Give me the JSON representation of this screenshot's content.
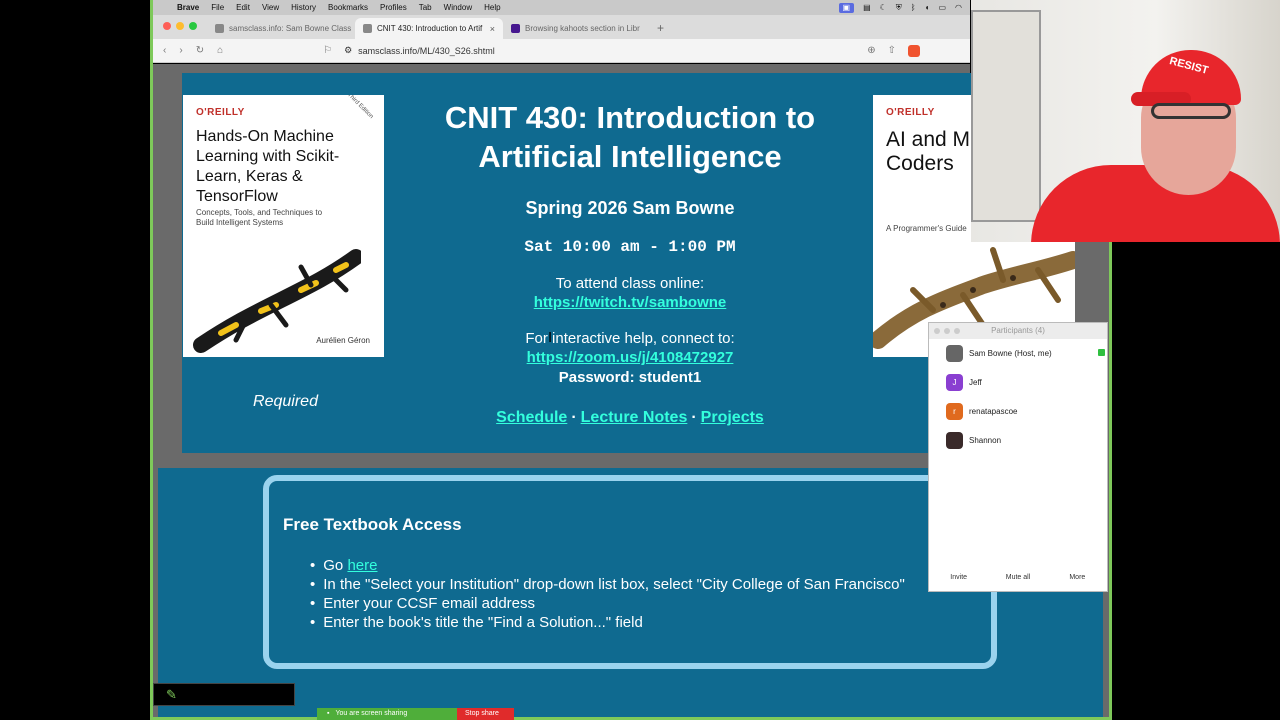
{
  "menubar": {
    "items": [
      "Brave",
      "File",
      "Edit",
      "View",
      "History",
      "Bookmarks",
      "Profiles",
      "Tab",
      "Window",
      "Help"
    ]
  },
  "tabs": [
    {
      "title": "samsclass.info: Sam Bowne Class"
    },
    {
      "title": "CNIT 430: Introduction to Artif"
    },
    {
      "title": "Browsing kahoots section in Libr"
    }
  ],
  "address": {
    "url": "samsclass.info/ML/430_S26.shtml"
  },
  "hero": {
    "title": "CNIT 430: Introduction to Artificial Intelligence",
    "semester": "Spring 2026 Sam Bowne",
    "time": "Sat 10:00 am - 1:00 PM",
    "attend_label": "To attend class online:",
    "twitch_link": "https://twitch.tv/sambowne",
    "help_label": "For interactive help, connect to:",
    "zoom_link": "https://zoom.us/j/4108472927",
    "password": "Password: student1",
    "required": "Required",
    "nav": {
      "schedule": "Schedule",
      "lecture_notes": "Lecture Notes",
      "projects": "Projects",
      "sep": "·"
    }
  },
  "books": {
    "left": {
      "publisher": "O'REILLY",
      "title": "Hands-On Machine Learning with Scikit-Learn, Keras & TensorFlow",
      "subtitle": "Concepts, Tools, and Techniques to Build Intelligent Systems",
      "edition": "Third Edition",
      "author": "Aurélien Géron"
    },
    "right": {
      "publisher": "O'REILLY",
      "title": "AI and M Learnin Coders",
      "subtitle": "A Programmer's Guide"
    }
  },
  "textbook": {
    "title": "Free Textbook Access",
    "item1_prefix": "Go",
    "item1_link": "here",
    "item2": "In the \"Select your Institution\" drop-down list box, select \"City College of San Francisco\"",
    "item3": "Enter your CCSF email address",
    "item4": "Enter the book's title the \"Find a Solution...\" field"
  },
  "webcam": {
    "cap_text": "RESIST"
  },
  "participants": {
    "title": "Participants (4)",
    "list": [
      {
        "name": "Sam Bowne (Host, me)",
        "initial": "",
        "color": "#666666"
      },
      {
        "name": "Jeff",
        "initial": "J",
        "color": "#8a3fd1"
      },
      {
        "name": "renatapascoe",
        "initial": "r",
        "color": "#e06a1e"
      },
      {
        "name": "Shannon",
        "initial": "",
        "color": "#3a2a2a"
      }
    ],
    "invite": "Invite",
    "mute_all": "Mute all",
    "more": "More"
  },
  "sharebar": {
    "status": "You are screen sharing",
    "stop": "Stop share"
  }
}
